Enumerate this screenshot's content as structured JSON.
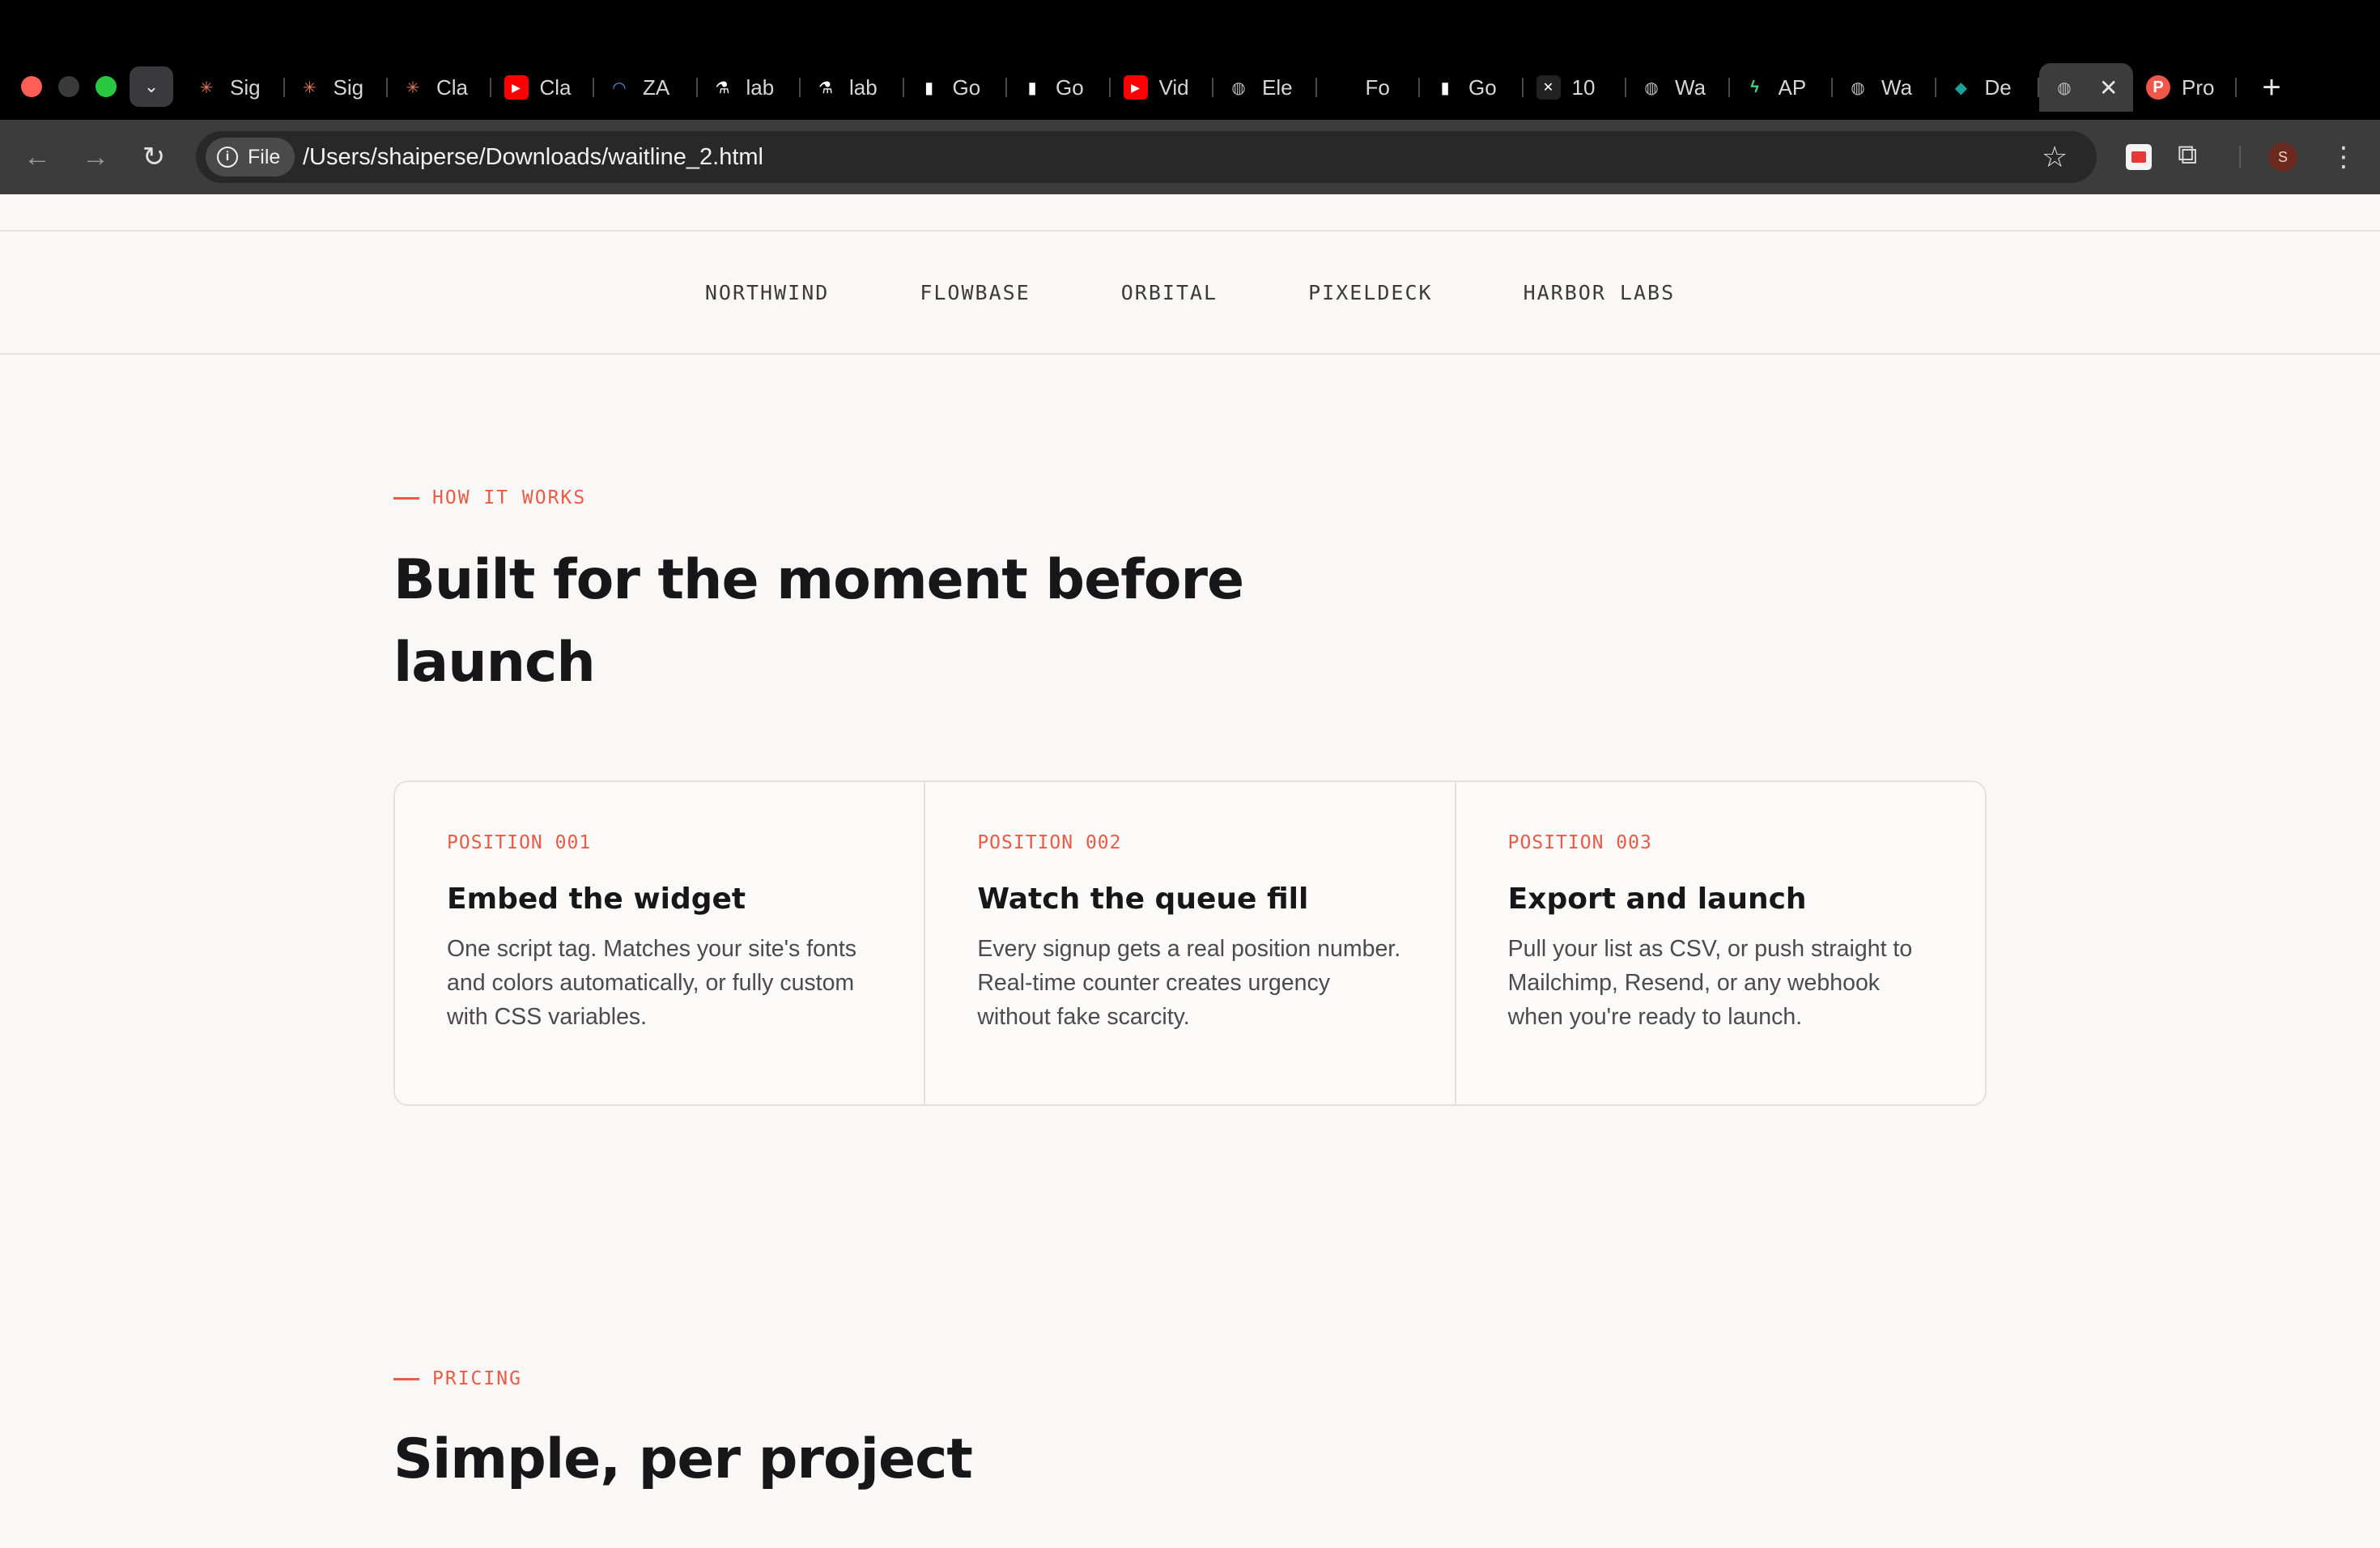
{
  "browser": {
    "tabs": [
      {
        "label": "Sig",
        "icon": "claude-asterisk-icon",
        "color": "#e8795a"
      },
      {
        "label": "Sig",
        "icon": "claude-asterisk-icon",
        "color": "#e8795a"
      },
      {
        "label": "Cla",
        "icon": "claude-asterisk-icon",
        "color": "#e8795a"
      },
      {
        "label": "Cla",
        "icon": "youtube-icon",
        "color": "#ff0000"
      },
      {
        "label": "ZA",
        "icon": "rainbow-icon",
        "color": "#5a8dee"
      },
      {
        "label": "lab",
        "icon": "flask-icon",
        "color": "#ffffff"
      },
      {
        "label": "lab",
        "icon": "flask-icon",
        "color": "#ffffff"
      },
      {
        "label": "Go",
        "icon": "document-icon",
        "color": "#ffffff"
      },
      {
        "label": "Go",
        "icon": "document-icon",
        "color": "#ffffff"
      },
      {
        "label": "Vid",
        "icon": "youtube-icon",
        "color": "#ff0000"
      },
      {
        "label": "Ele",
        "icon": "globe-icon",
        "color": "#bdbdbd"
      },
      {
        "label": "Fo",
        "icon": "blank-icon",
        "color": "#000000"
      },
      {
        "label": "Go",
        "icon": "document-icon",
        "color": "#ffffff"
      },
      {
        "label": "10",
        "icon": "x-icon",
        "color": "#222222"
      },
      {
        "label": "Wa",
        "icon": "globe-icon",
        "color": "#bdbdbd"
      },
      {
        "label": "AP",
        "icon": "bolt-icon",
        "color": "#3ddc84"
      },
      {
        "label": "Wa",
        "icon": "globe-icon",
        "color": "#bdbdbd"
      },
      {
        "label": "De",
        "icon": "leaf-icon",
        "color": "#1aa39a"
      }
    ],
    "active_tab": {
      "icon": "globe-icon",
      "close": "✕"
    },
    "last_tab": {
      "label": "Pro",
      "icon": "p-circle-icon",
      "color": "#f0564a",
      "letter": "P"
    },
    "new_tab": "+",
    "chip_label": "File",
    "url": "/Users/shaiperse/Downloads/waitline_2.html",
    "avatar_letter": "S"
  },
  "logos": [
    "NORTHWIND",
    "FLOWBASE",
    "ORBITAL",
    "PIXELDECK",
    "HARBOR LABS"
  ],
  "how": {
    "eyebrow": "HOW IT WORKS",
    "title_line1": "Built for the moment before",
    "title_line2": "launch",
    "cards": [
      {
        "position": "POSITION 001",
        "title": "Embed the widget",
        "desc": "One script tag. Matches your site's fonts and colors automatically, or fully custom with CSS variables."
      },
      {
        "position": "POSITION 002",
        "title": "Watch the queue fill",
        "desc": "Every signup gets a real position number. Real-time counter creates urgency without fake scarcity."
      },
      {
        "position": "POSITION 003",
        "title": "Export and launch",
        "desc": "Pull your list as CSV, or push straight to Mailchimp, Resend, or any webhook when you're ready to launch."
      }
    ]
  },
  "pricing": {
    "eyebrow": "PRICING",
    "title": "Simple, per project"
  },
  "colors": {
    "accent": "#ea5a45",
    "page_bg": "#f9f8f6",
    "text": "#17171a"
  }
}
